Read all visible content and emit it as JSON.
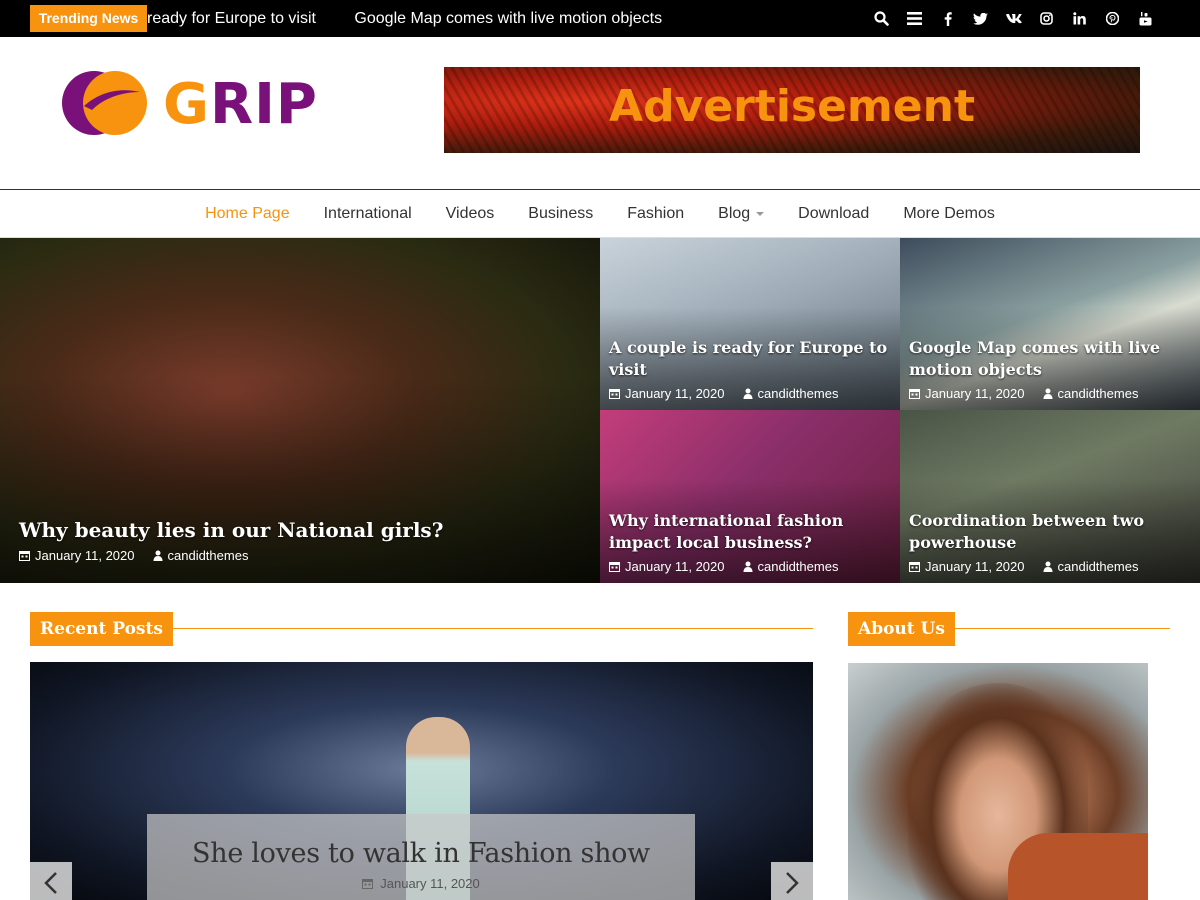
{
  "topbar": {
    "trending_label": "Trending News",
    "ticker": [
      "ready for Europe to visit",
      "Google Map comes with live motion objects"
    ],
    "icons": [
      "search-icon",
      "menu-icon",
      "facebook-icon",
      "twitter-icon",
      "vk-icon",
      "instagram-icon",
      "linkedin-icon",
      "pinterest-icon",
      "youtube-icon"
    ]
  },
  "header": {
    "logo_text_first": "G",
    "logo_text_rest": "RIP",
    "ad_text": "Advertisement"
  },
  "nav": {
    "items": [
      {
        "label": "Home Page",
        "active": true
      },
      {
        "label": "International"
      },
      {
        "label": "Videos"
      },
      {
        "label": "Business"
      },
      {
        "label": "Fashion"
      },
      {
        "label": "Blog",
        "dropdown": true
      },
      {
        "label": "Download"
      },
      {
        "label": "More Demos"
      }
    ]
  },
  "hero": {
    "main": {
      "title": "Why beauty lies in our National girls?",
      "date": "January 11, 2020",
      "author": "candidthemes"
    },
    "tiles": [
      {
        "title": "A couple is ready for Europe to visit",
        "date": "January 11, 2020",
        "author": "candidthemes"
      },
      {
        "title": "Google Map comes with live motion objects",
        "date": "January 11, 2020",
        "author": "candidthemes"
      },
      {
        "title": "Why international fashion impact local business?",
        "date": "January 11, 2020",
        "author": "candidthemes"
      },
      {
        "title": "Coordination between two powerhouse",
        "date": "January 11, 2020",
        "author": "candidthemes"
      }
    ]
  },
  "recent": {
    "heading": "Recent Posts",
    "slide": {
      "title": "She loves to walk in Fashion show",
      "date": "January 11, 2020"
    }
  },
  "about": {
    "heading": "About Us"
  },
  "colors": {
    "accent": "#f7930e",
    "brand_purple": "#7a117a",
    "topbar": "#000000"
  }
}
